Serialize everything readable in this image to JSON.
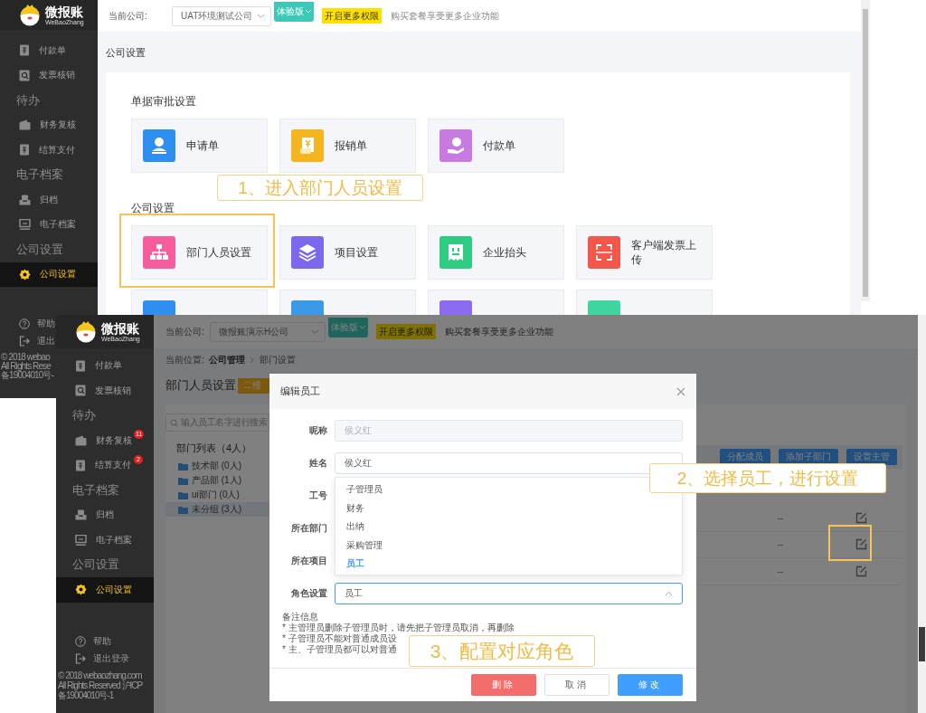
{
  "top_window": {
    "logo": {
      "name": "微报账",
      "subtitle": "WeBaoZhang"
    },
    "sidebar": {
      "items": [
        {
          "kind": "item",
          "label": "付款单",
          "selected": false
        },
        {
          "kind": "item",
          "label": "发票核销",
          "selected": false
        },
        {
          "kind": "group",
          "label": "待办"
        },
        {
          "kind": "item",
          "label": "财务复核",
          "selected": false
        },
        {
          "kind": "item",
          "label": "结算支付",
          "selected": false
        },
        {
          "kind": "group",
          "label": "电子档案"
        },
        {
          "kind": "item",
          "label": "归档",
          "selected": false
        },
        {
          "kind": "item",
          "label": "电子档案",
          "selected": false
        },
        {
          "kind": "group",
          "label": "公司设置"
        },
        {
          "kind": "item",
          "label": "公司设置",
          "selected": true
        }
      ],
      "footer": {
        "help": "帮助",
        "logout": "退出",
        "copyright": [
          "© 2018 webao",
          "All Rights Rese",
          "备19004010号-"
        ]
      }
    },
    "header": {
      "company_label": "当前公司:",
      "company": "UAT环境测试公司",
      "edition": "体验版",
      "upgrade_button": "开启更多权限",
      "promo": "购买套餐享受更多企业功能"
    },
    "page_title": "公司设置",
    "sections": [
      {
        "title": "单据审批设置",
        "tiles": [
          {
            "label": "申请单",
            "color": "#2f8ff0"
          },
          {
            "label": "报销单",
            "color": "#f5b51f"
          },
          {
            "label": "付款单",
            "color": "#c77be0"
          }
        ]
      },
      {
        "title": "公司设置",
        "tiles": [
          {
            "label": "部门人员设置",
            "color": "#f75c9c"
          },
          {
            "label": "项目设置",
            "color": "#7b68ee"
          },
          {
            "label": "企业抬头",
            "color": "#2ecc80"
          },
          {
            "label": "客户端发票上传",
            "color": "#f5564a"
          },
          {
            "color": "#2f8ff0"
          },
          {
            "color": "#3a9ae8"
          },
          {
            "color": "#8b6cf0"
          },
          {
            "color": "#3fd6a0"
          }
        ]
      }
    ]
  },
  "bottom_window": {
    "logo": {
      "name": "微报账",
      "subtitle": "WeBaoZhang"
    },
    "sidebar": {
      "items": [
        {
          "kind": "item",
          "label": "付款单",
          "selected": false
        },
        {
          "kind": "item",
          "label": "发票核销",
          "selected": false
        },
        {
          "kind": "group",
          "label": "待办"
        },
        {
          "kind": "item",
          "label": "财务复核",
          "selected": false,
          "badge": "11"
        },
        {
          "kind": "item",
          "label": "结算支付",
          "selected": false,
          "badge": "2"
        },
        {
          "kind": "group",
          "label": "电子档案"
        },
        {
          "kind": "item",
          "label": "归档",
          "selected": false
        },
        {
          "kind": "item",
          "label": "电子档案",
          "selected": false
        },
        {
          "kind": "group",
          "label": "公司设置"
        },
        {
          "kind": "item",
          "label": "公司设置",
          "selected": true
        }
      ],
      "footer": {
        "help": "帮助",
        "logout": "退出登录",
        "copyright": [
          "© 2018 webaozhang.com",
          "All Rights Reserved 沪ICP",
          "备19004010号-1"
        ]
      }
    },
    "header": {
      "company_label": "当前公司:",
      "company": "微报账演示H公司",
      "edition": "体验版",
      "upgrade_button": "开启更多权限",
      "promo": "购买套餐享受更多企业功能"
    },
    "breadcrumb": {
      "label": "当前位置:",
      "path": [
        "公司管理",
        "部门设置"
      ]
    },
    "page_title": "部门人员设置",
    "qr_button": "二维",
    "search": {
      "placeholder": "输入员工名字进行搜索"
    },
    "department_list": {
      "title": "部门列表（4人）",
      "items": [
        {
          "label": "技术部 (0人)",
          "selected": false
        },
        {
          "label": "产品部 (1人)",
          "selected": false
        },
        {
          "label": "ui部门 (0人)",
          "selected": false
        },
        {
          "label": "未分组 (3人)",
          "selected": true
        }
      ]
    },
    "member_actions": [
      "分配成员",
      "添加子部门",
      "设置主管"
    ],
    "member_rows": [
      {
        "column_1": "--"
      },
      {
        "column_1": "--"
      },
      {
        "column_1": "--"
      }
    ]
  },
  "modal": {
    "title": "编辑员工",
    "fields": [
      {
        "label": "昵称",
        "kind": "text",
        "value": "侯义红",
        "disabled": true
      },
      {
        "label": "姓名",
        "kind": "text",
        "value": "侯义红",
        "disabled": false
      },
      {
        "label": "工号",
        "kind": "covered"
      },
      {
        "label": "所在部门",
        "kind": "covered"
      },
      {
        "label": "所在项目",
        "kind": "covered"
      },
      {
        "label": "角色设置",
        "kind": "select",
        "value": "员工",
        "expanded": true
      }
    ],
    "role_options": [
      {
        "label": "子管理员",
        "selected": false
      },
      {
        "label": "财务",
        "selected": false
      },
      {
        "label": "出纳",
        "selected": false
      },
      {
        "label": "采购管理",
        "selected": false
      },
      {
        "label": "员工",
        "selected": true
      }
    ],
    "notes": {
      "title": "备注信息",
      "lines": [
        "* 主管理员删除子管理员时，请先把子管理员取消，再删除",
        "* 子管理员不能对普通成员设",
        "* 主、子管理员都可以对普通"
      ]
    },
    "buttons": [
      {
        "label": "删除",
        "kind": "danger"
      },
      {
        "label": "取消",
        "kind": "default"
      },
      {
        "label": "修改",
        "kind": "primary"
      }
    ]
  },
  "annotations": [
    {
      "text": "1、进入部门人员设置"
    },
    {
      "text": "2、选择员工，进行设置"
    },
    {
      "text": "3、配置对应角色"
    }
  ]
}
